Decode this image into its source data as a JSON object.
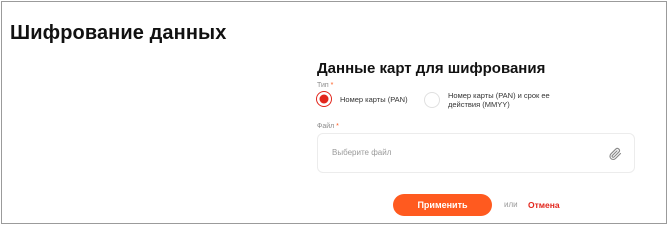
{
  "page": {
    "title": "Шифрование данных"
  },
  "form": {
    "section_title": "Данные карт для шифрования",
    "type_field": {
      "label": "Тип",
      "required_mark": "*",
      "options": [
        {
          "label": "Номер карты (PAN)",
          "selected": true
        },
        {
          "label": "Номер карты (PAN) и срок ее действия (MMYY)",
          "selected": false
        }
      ]
    },
    "file_field": {
      "label": "Файл",
      "required_mark": "*",
      "placeholder": "Выберите файл",
      "icon": "paperclip-icon"
    },
    "actions": {
      "apply_label": "Применить",
      "separator": "или",
      "cancel_label": "Отмена"
    }
  },
  "colors": {
    "accent": "#ff5a1f",
    "radio_selected": "#e2261c",
    "cancel_link": "#e2261c"
  }
}
